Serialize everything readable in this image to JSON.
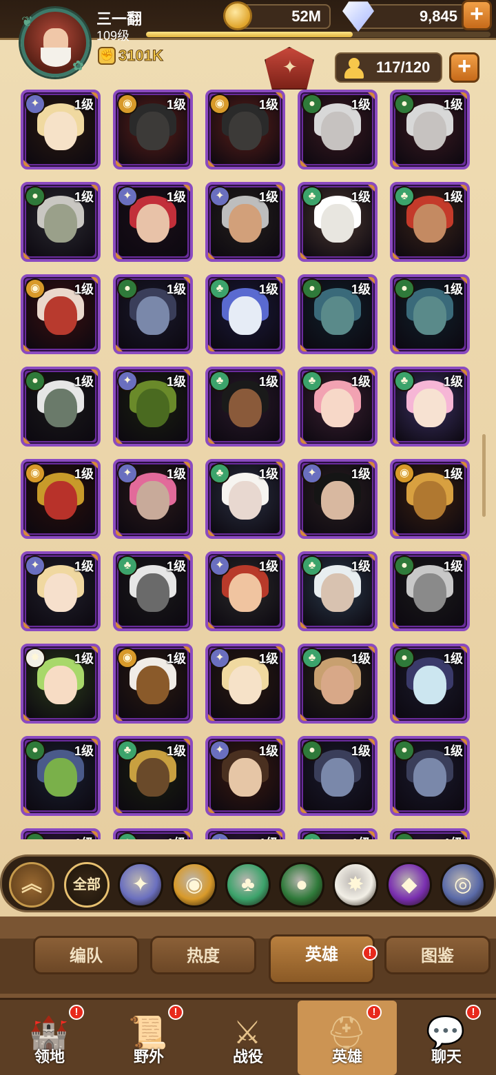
{
  "player": {
    "name": "三一翻",
    "level": "109级",
    "power": "3101K",
    "xp_progress": 0.6
  },
  "resources": {
    "gold": "52M",
    "gems": "9,845"
  },
  "hero_slots": "117/120",
  "factions": {
    "lightbearer": {
      "symbol": "✦",
      "color": "#6a6fbf"
    },
    "mauler": {
      "symbol": "◉",
      "color": "#d89a2a"
    },
    "wilder": {
      "symbol": "♣",
      "color": "#3ca36b"
    },
    "graveborn": {
      "symbol": "●",
      "color": "#2f7a3a"
    },
    "celestial": {
      "symbol": "✸",
      "color": "#f2efe6"
    },
    "hypogean": {
      "symbol": "◆",
      "color": "#7a2fb0"
    },
    "dimensional": {
      "symbol": "◎",
      "color": "#5a6aa8"
    }
  },
  "hero_grid": [
    {
      "faction": "lightbearer",
      "level": "1级",
      "portrait": "blonde-maid"
    },
    {
      "faction": "mauler",
      "level": "1级",
      "portrait": "dark-wolf"
    },
    {
      "faction": "mauler",
      "level": "1级",
      "portrait": "dark-wolf"
    },
    {
      "faction": "graveborn",
      "level": "1级",
      "portrait": "pale-vampire"
    },
    {
      "faction": "graveborn",
      "level": "1级",
      "portrait": "pale-vampire"
    },
    {
      "faction": "graveborn",
      "level": "1级",
      "portrait": "owl-knight"
    },
    {
      "faction": "lightbearer",
      "level": "1级",
      "portrait": "red-witch"
    },
    {
      "faction": "lightbearer",
      "level": "1级",
      "portrait": "grey-warrior"
    },
    {
      "faction": "wilder",
      "level": "1级",
      "portrait": "white-goat"
    },
    {
      "faction": "wilder",
      "level": "1级",
      "portrait": "tribal-elder"
    },
    {
      "faction": "mauler",
      "level": "1级",
      "portrait": "horned-demon"
    },
    {
      "faction": "graveborn",
      "level": "1级",
      "portrait": "undead-elf"
    },
    {
      "faction": "wilder",
      "level": "1级",
      "portrait": "frost-wolf"
    },
    {
      "faction": "graveborn",
      "level": "1级",
      "portrait": "teal-ghoul"
    },
    {
      "faction": "graveborn",
      "level": "1级",
      "portrait": "teal-ghoul"
    },
    {
      "faction": "graveborn",
      "level": "1级",
      "portrait": "white-hair-girl"
    },
    {
      "faction": "lightbearer",
      "level": "1级",
      "portrait": "green-serpent"
    },
    {
      "faction": "wilder",
      "level": "1级",
      "portrait": "dark-elf"
    },
    {
      "faction": "wilder",
      "level": "1级",
      "portrait": "pink-archer"
    },
    {
      "faction": "wilder",
      "level": "1级",
      "portrait": "pink-fairy"
    },
    {
      "faction": "mauler",
      "level": "1级",
      "portrait": "gold-helmet"
    },
    {
      "faction": "lightbearer",
      "level": "1级",
      "portrait": "pink-hair-rogue"
    },
    {
      "faction": "wilder",
      "level": "1级",
      "portrait": "white-lamb"
    },
    {
      "faction": "lightbearer",
      "level": "1级",
      "portrait": "black-hair-noble"
    },
    {
      "faction": "mauler",
      "level": "1级",
      "portrait": "lion-king"
    },
    {
      "faction": "lightbearer",
      "level": "1级",
      "portrait": "blonde-bun"
    },
    {
      "faction": "wilder",
      "level": "1级",
      "portrait": "white-beast"
    },
    {
      "faction": "lightbearer",
      "level": "1级",
      "portrait": "red-dwarf"
    },
    {
      "faction": "wilder",
      "level": "1级",
      "portrait": "white-hair-elf"
    },
    {
      "faction": "graveborn",
      "level": "1级",
      "portrait": "grey-lady"
    },
    {
      "faction": "celestial",
      "level": "1级",
      "portrait": "green-hair-girl"
    },
    {
      "faction": "mauler",
      "level": "1级",
      "portrait": "eagle-warrior"
    },
    {
      "faction": "lightbearer",
      "level": "1级",
      "portrait": "blonde-maid"
    },
    {
      "faction": "wilder",
      "level": "1级",
      "portrait": "elf-priest"
    },
    {
      "faction": "graveborn",
      "level": "1级",
      "portrait": "masked-lady"
    },
    {
      "faction": "graveborn",
      "level": "1级",
      "portrait": "green-goblins"
    },
    {
      "faction": "wilder",
      "level": "1级",
      "portrait": "gold-horned-beast"
    },
    {
      "faction": "lightbearer",
      "level": "1级",
      "portrait": "dwarf-hunter"
    },
    {
      "faction": "graveborn",
      "level": "1级",
      "portrait": "undead-elf"
    },
    {
      "faction": "graveborn",
      "level": "1级",
      "portrait": "undead-elf"
    },
    {
      "faction": "graveborn",
      "level": "1级",
      "portrait": "partial"
    },
    {
      "faction": "wilder",
      "level": "1级",
      "portrait": "partial"
    },
    {
      "faction": "lightbearer",
      "level": "1级",
      "portrait": "partial"
    },
    {
      "faction": "wilder",
      "level": "1级",
      "portrait": "partial"
    },
    {
      "faction": "graveborn",
      "level": "1级",
      "portrait": "partial"
    }
  ],
  "filter_bar": {
    "all_label": "全部",
    "icons": [
      "chevron-up-icon",
      "all-factions-filter",
      "lightbearer-icon",
      "mauler-icon",
      "wilder-icon",
      "graveborn-icon",
      "celestial-icon",
      "hypogean-icon",
      "dimensional-icon"
    ]
  },
  "sub_tabs": [
    {
      "label": "编队",
      "active": false,
      "alert": false
    },
    {
      "label": "热度",
      "active": false,
      "alert": false
    },
    {
      "label": "英雄",
      "active": true,
      "alert": true
    },
    {
      "label": "图鉴",
      "active": false,
      "alert": false
    }
  ],
  "bottom_nav": [
    {
      "label": "领地",
      "icon": "castle-icon",
      "alert": true,
      "active": false
    },
    {
      "label": "野外",
      "icon": "scroll-map-icon",
      "alert": true,
      "active": false
    },
    {
      "label": "战役",
      "icon": "sword-shield-icon",
      "alert": false,
      "active": false
    },
    {
      "label": "英雄",
      "icon": "hero-helmet-icon",
      "alert": true,
      "active": true
    },
    {
      "label": "聊天",
      "icon": "chat-bubble-icon",
      "alert": true,
      "active": false
    }
  ],
  "alert_mark": "!"
}
